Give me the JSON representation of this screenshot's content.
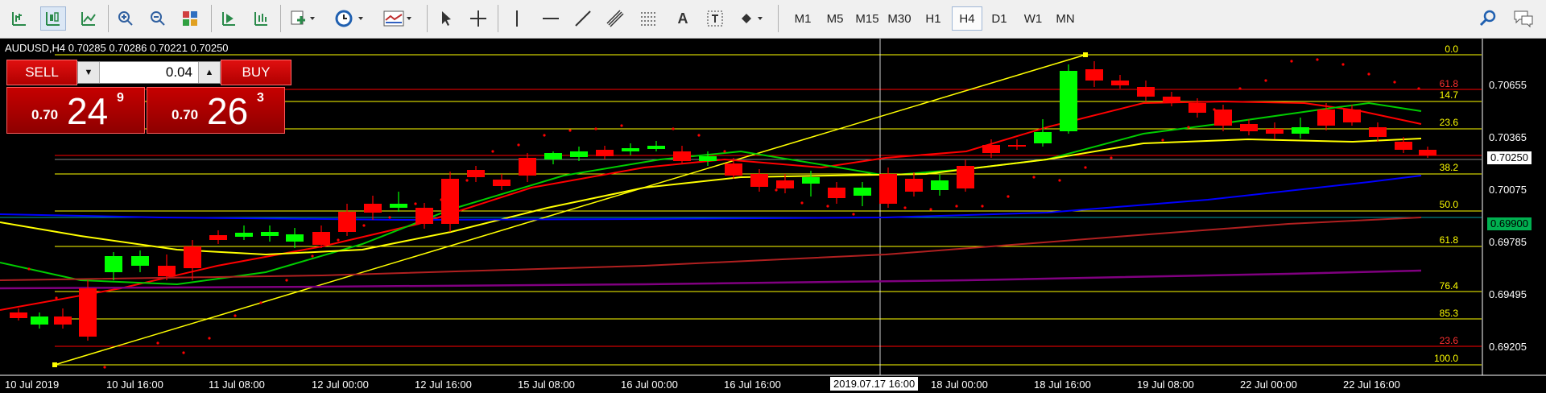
{
  "toolbar": {
    "timeframes": [
      "M1",
      "M5",
      "M15",
      "M30",
      "H1",
      "H4",
      "D1",
      "W1",
      "MN"
    ],
    "active_timeframe": "H4"
  },
  "chart": {
    "symbol_info": "AUDUSD,H4  0.70285 0.70286 0.70221 0.70250",
    "trade_panel": {
      "sell_label": "SELL",
      "buy_label": "BUY",
      "lot_value": "0.04",
      "sell_prefix": "0.70",
      "sell_big": "24",
      "sell_sup": "9",
      "buy_prefix": "0.70",
      "buy_big": "26",
      "buy_sup": "3"
    },
    "price_axis": [
      "0.70655",
      "0.70365",
      "0.70075",
      "0.69785",
      "0.69495",
      "0.69205"
    ],
    "current_price": "0.70250",
    "line_price": "0.69900",
    "fib_levels_upper": [
      "0.0",
      "61.8",
      "14.7",
      "23.6",
      "38.2",
      "50.0",
      "61.8",
      "76.4",
      "85.3",
      "23.6",
      "100.0"
    ],
    "fib_hidden": "50.0",
    "time_axis": [
      "10 Jul 2019",
      "10 Jul 16:00",
      "11 Jul 08:00",
      "12 Jul 00:00",
      "12 Jul 16:00",
      "15 Jul 08:00",
      "16 Jul 00:00",
      "16 Jul 16:00",
      "18 Jul 00:00",
      "18 Jul 16:00",
      "19 Jul 08:00",
      "22 Jul 00:00",
      "22 Jul 16:00"
    ],
    "crosshair_time": "2019.07.17 16:00",
    "colors": {
      "bull": "#00ff00",
      "bear": "#ff0000",
      "fib": "#ffff00",
      "ma_fast": "#ff0000",
      "ma_mid": "#00cc00",
      "ma_slow": "#ffff00",
      "ma_blue": "#0000ff",
      "ma_darkred": "#b02020",
      "ma_purple": "#800080"
    }
  }
}
